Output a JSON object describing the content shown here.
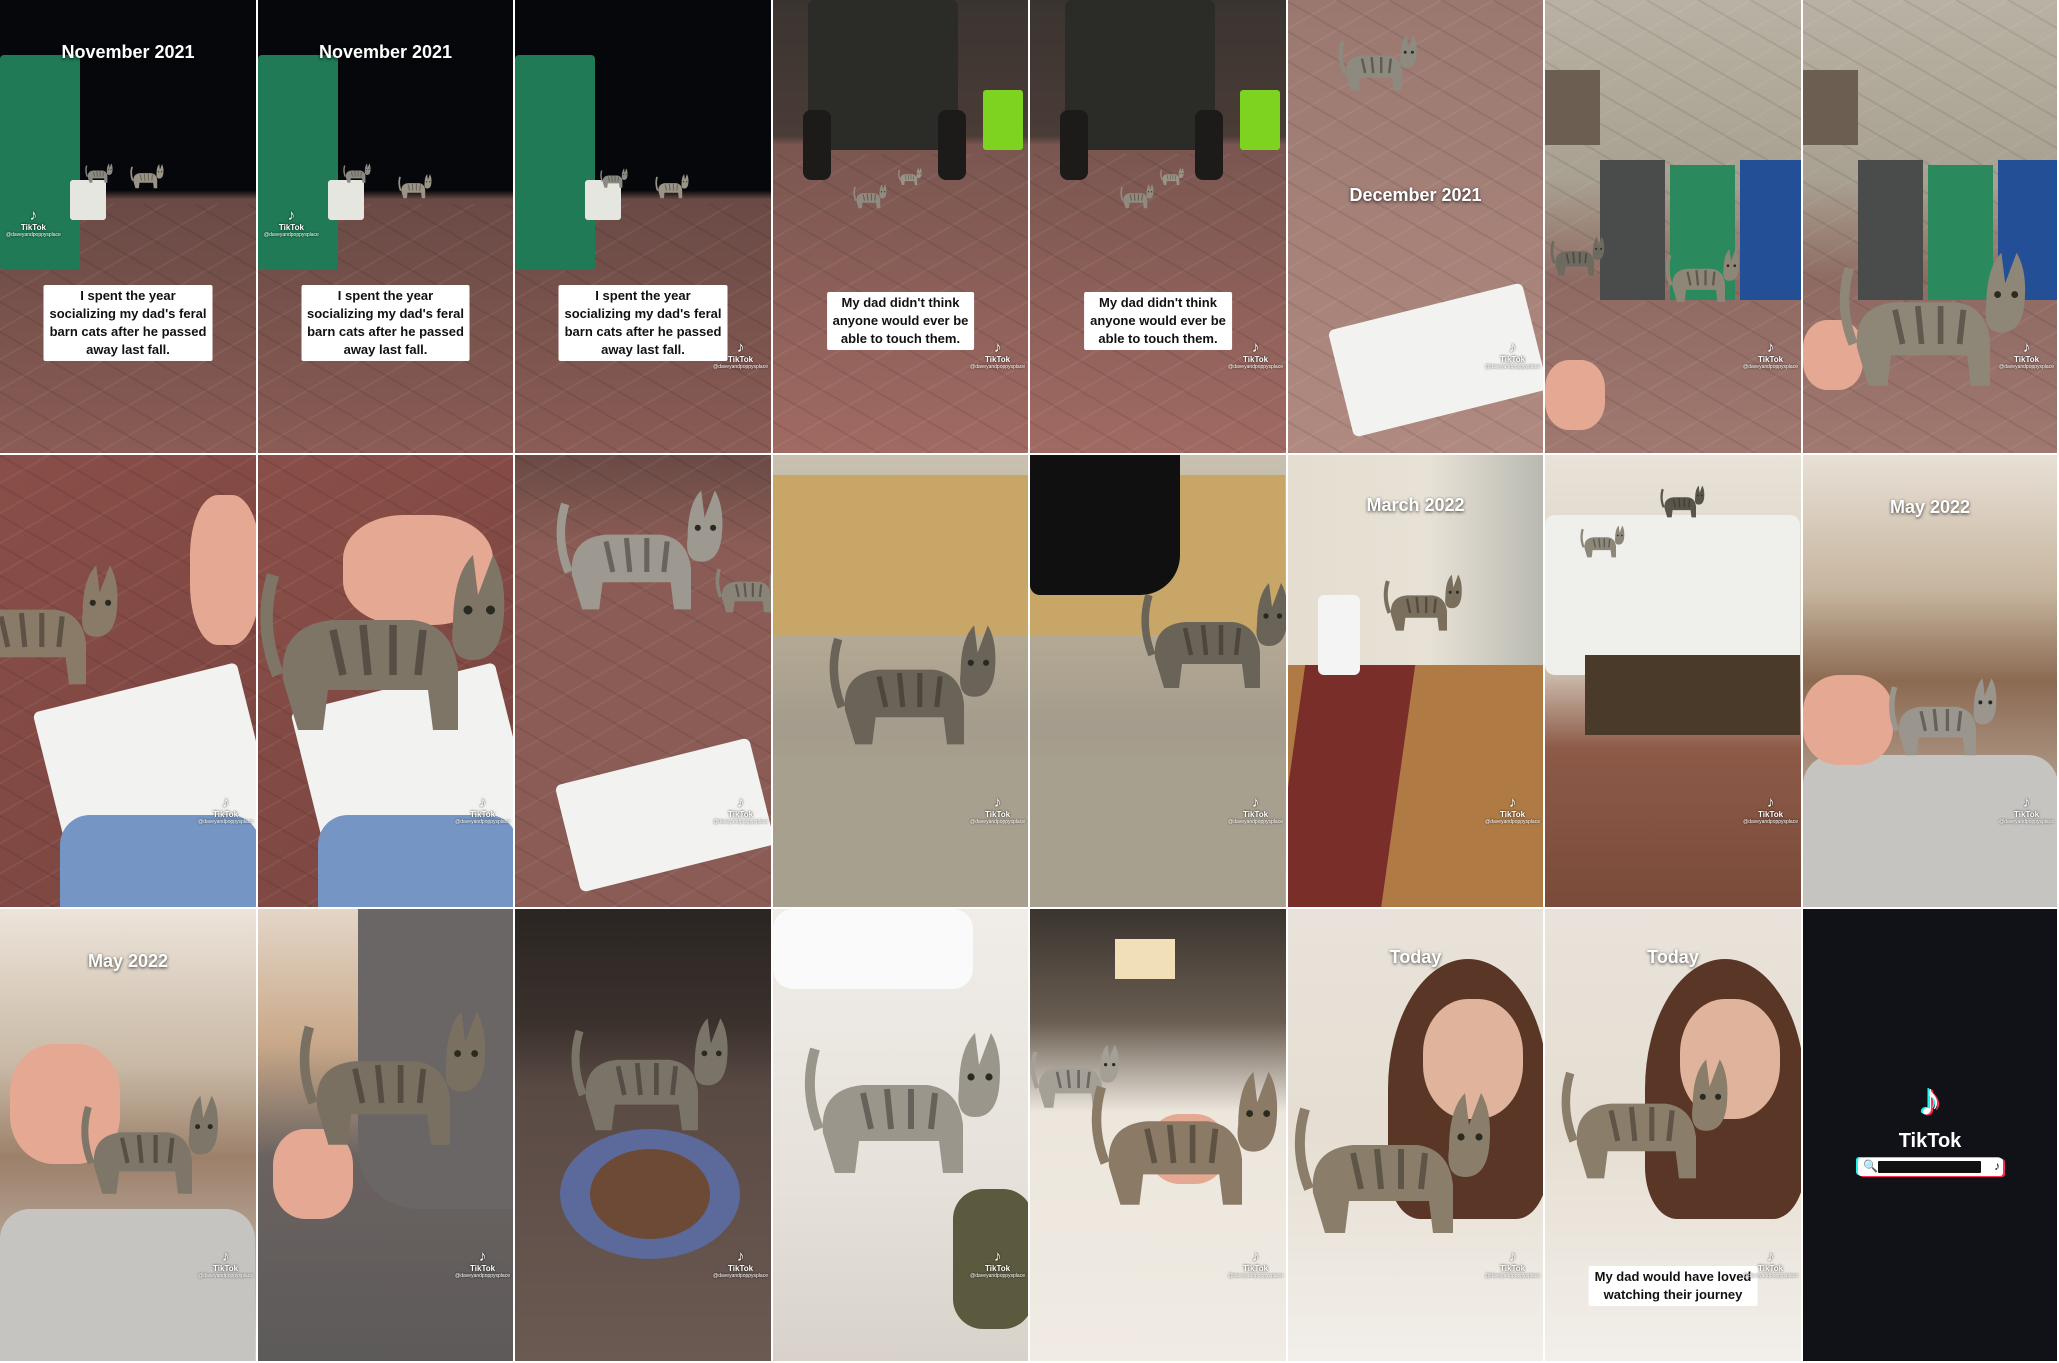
{
  "colors": {
    "tiktok_cyan": "#25f4ee",
    "tiktok_red": "#fe2c55",
    "end_background": "#111217",
    "caption_bg": "#ffffff"
  },
  "watermark": {
    "brand": "TikTok",
    "glyph": "♪",
    "handle": "@daveyandpoppysplace"
  },
  "frames": [
    {
      "date": "November 2021",
      "caption": [
        "I spent the year",
        "socializing my dad's feral",
        "barn cats after he passed",
        "away last fall."
      ]
    },
    {
      "date": "November 2021",
      "caption": [
        "I spent the year",
        "socializing my dad's feral",
        "barn cats after he passed",
        "away last fall."
      ]
    },
    {
      "date": "",
      "caption": [
        "I spent the year",
        "socializing my dad's feral",
        "barn cats after he passed",
        "away last fall."
      ]
    },
    {
      "date": "",
      "caption": [
        "My dad didn't think",
        "anyone would ever be",
        "able to touch them."
      ]
    },
    {
      "date": "",
      "caption": [
        "My dad didn't think",
        "anyone would ever be",
        "able to touch them."
      ]
    },
    {
      "date": "December 2021",
      "caption": []
    },
    {
      "date": "",
      "caption": []
    },
    {
      "date": "",
      "caption": []
    },
    {
      "date": "",
      "caption": []
    },
    {
      "date": "",
      "caption": []
    },
    {
      "date": "",
      "caption": []
    },
    {
      "date": "",
      "caption": []
    },
    {
      "date": "",
      "caption": []
    },
    {
      "date": "March 2022",
      "caption": []
    },
    {
      "date": "",
      "caption": []
    },
    {
      "date": "May 2022",
      "caption": []
    },
    {
      "date": "May 2022",
      "caption": []
    },
    {
      "date": "",
      "caption": []
    },
    {
      "date": "",
      "caption": []
    },
    {
      "date": "",
      "caption": []
    },
    {
      "date": "",
      "caption": []
    },
    {
      "date": "Today",
      "caption": []
    },
    {
      "date": "Today",
      "caption": [
        "My dad would have loved",
        "watching their journey"
      ]
    },
    {
      "date": "",
      "caption": []
    }
  ],
  "end_card": {
    "brand": "TikTok",
    "glyph": "♪",
    "search_icon": "🔍"
  }
}
